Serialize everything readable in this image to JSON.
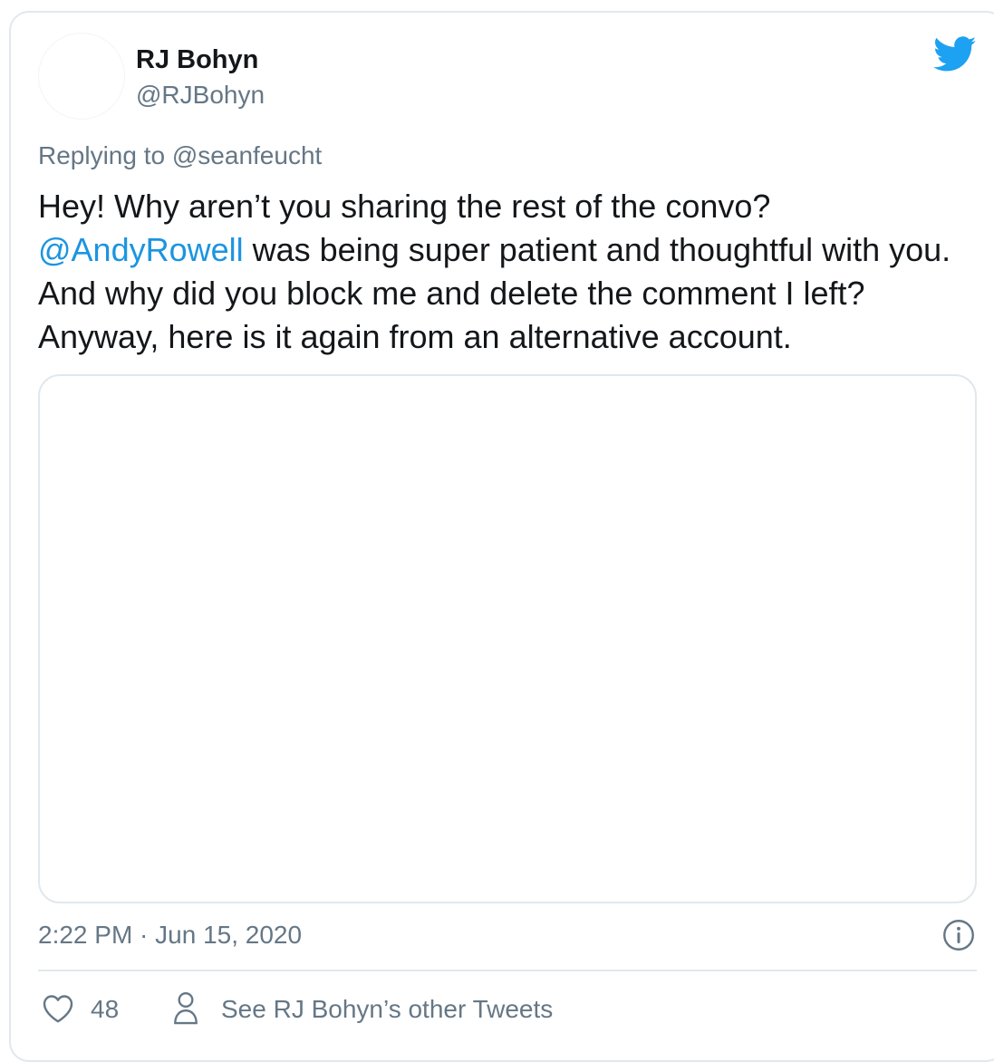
{
  "tweet": {
    "display_name": "RJ Bohyn",
    "handle": "@RJBohyn",
    "reply_prefix": "Replying to ",
    "reply_to": "@seanfeucht",
    "text_line1": "Hey! Why aren’t you sharing the rest of the convo?",
    "mention": "@AndyRowell",
    "text_after_mention": " was being super patient and thoughtful with you. And why did you block me and delete the comment I left? Anyway, here is it again from an alternative account.",
    "timestamp": "2:22 PM · Jun 15, 2020",
    "like_count": "48",
    "other_tweets_label": "See RJ Bohyn’s other Tweets"
  },
  "icons": {
    "brand": "twitter-bird-icon",
    "info": "info-icon",
    "like": "heart-icon",
    "profile": "person-icon"
  },
  "colors": {
    "brand": "#1da1f2",
    "mention": "#1b95e0",
    "secondary_text": "#657786",
    "primary_text": "#14171a",
    "border": "#e1e8ed"
  }
}
